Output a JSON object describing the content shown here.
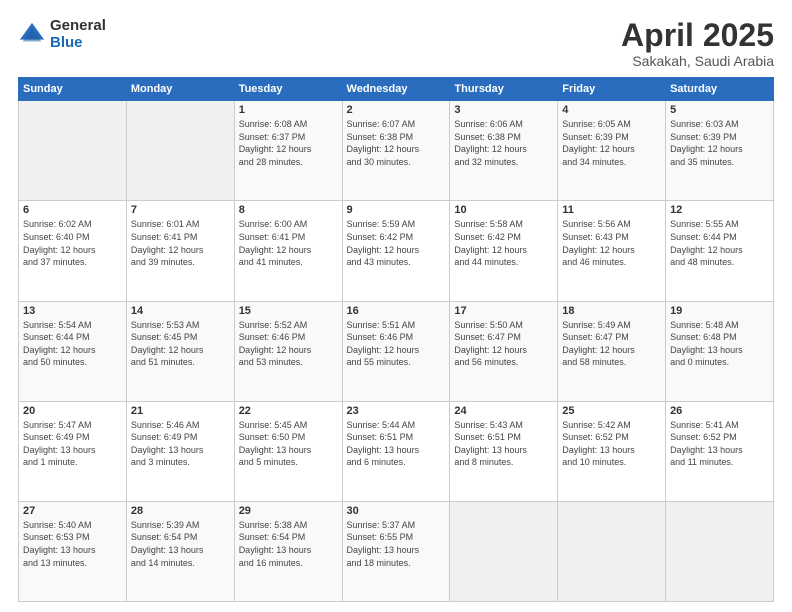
{
  "logo": {
    "general": "General",
    "blue": "Blue"
  },
  "title": "April 2025",
  "subtitle": "Sakakah, Saudi Arabia",
  "days_header": [
    "Sunday",
    "Monday",
    "Tuesday",
    "Wednesday",
    "Thursday",
    "Friday",
    "Saturday"
  ],
  "weeks": [
    [
      {
        "day": "",
        "info": ""
      },
      {
        "day": "",
        "info": ""
      },
      {
        "day": "1",
        "info": "Sunrise: 6:08 AM\nSunset: 6:37 PM\nDaylight: 12 hours\nand 28 minutes."
      },
      {
        "day": "2",
        "info": "Sunrise: 6:07 AM\nSunset: 6:38 PM\nDaylight: 12 hours\nand 30 minutes."
      },
      {
        "day": "3",
        "info": "Sunrise: 6:06 AM\nSunset: 6:38 PM\nDaylight: 12 hours\nand 32 minutes."
      },
      {
        "day": "4",
        "info": "Sunrise: 6:05 AM\nSunset: 6:39 PM\nDaylight: 12 hours\nand 34 minutes."
      },
      {
        "day": "5",
        "info": "Sunrise: 6:03 AM\nSunset: 6:39 PM\nDaylight: 12 hours\nand 35 minutes."
      }
    ],
    [
      {
        "day": "6",
        "info": "Sunrise: 6:02 AM\nSunset: 6:40 PM\nDaylight: 12 hours\nand 37 minutes."
      },
      {
        "day": "7",
        "info": "Sunrise: 6:01 AM\nSunset: 6:41 PM\nDaylight: 12 hours\nand 39 minutes."
      },
      {
        "day": "8",
        "info": "Sunrise: 6:00 AM\nSunset: 6:41 PM\nDaylight: 12 hours\nand 41 minutes."
      },
      {
        "day": "9",
        "info": "Sunrise: 5:59 AM\nSunset: 6:42 PM\nDaylight: 12 hours\nand 43 minutes."
      },
      {
        "day": "10",
        "info": "Sunrise: 5:58 AM\nSunset: 6:42 PM\nDaylight: 12 hours\nand 44 minutes."
      },
      {
        "day": "11",
        "info": "Sunrise: 5:56 AM\nSunset: 6:43 PM\nDaylight: 12 hours\nand 46 minutes."
      },
      {
        "day": "12",
        "info": "Sunrise: 5:55 AM\nSunset: 6:44 PM\nDaylight: 12 hours\nand 48 minutes."
      }
    ],
    [
      {
        "day": "13",
        "info": "Sunrise: 5:54 AM\nSunset: 6:44 PM\nDaylight: 12 hours\nand 50 minutes."
      },
      {
        "day": "14",
        "info": "Sunrise: 5:53 AM\nSunset: 6:45 PM\nDaylight: 12 hours\nand 51 minutes."
      },
      {
        "day": "15",
        "info": "Sunrise: 5:52 AM\nSunset: 6:46 PM\nDaylight: 12 hours\nand 53 minutes."
      },
      {
        "day": "16",
        "info": "Sunrise: 5:51 AM\nSunset: 6:46 PM\nDaylight: 12 hours\nand 55 minutes."
      },
      {
        "day": "17",
        "info": "Sunrise: 5:50 AM\nSunset: 6:47 PM\nDaylight: 12 hours\nand 56 minutes."
      },
      {
        "day": "18",
        "info": "Sunrise: 5:49 AM\nSunset: 6:47 PM\nDaylight: 12 hours\nand 58 minutes."
      },
      {
        "day": "19",
        "info": "Sunrise: 5:48 AM\nSunset: 6:48 PM\nDaylight: 13 hours\nand 0 minutes."
      }
    ],
    [
      {
        "day": "20",
        "info": "Sunrise: 5:47 AM\nSunset: 6:49 PM\nDaylight: 13 hours\nand 1 minute."
      },
      {
        "day": "21",
        "info": "Sunrise: 5:46 AM\nSunset: 6:49 PM\nDaylight: 13 hours\nand 3 minutes."
      },
      {
        "day": "22",
        "info": "Sunrise: 5:45 AM\nSunset: 6:50 PM\nDaylight: 13 hours\nand 5 minutes."
      },
      {
        "day": "23",
        "info": "Sunrise: 5:44 AM\nSunset: 6:51 PM\nDaylight: 13 hours\nand 6 minutes."
      },
      {
        "day": "24",
        "info": "Sunrise: 5:43 AM\nSunset: 6:51 PM\nDaylight: 13 hours\nand 8 minutes."
      },
      {
        "day": "25",
        "info": "Sunrise: 5:42 AM\nSunset: 6:52 PM\nDaylight: 13 hours\nand 10 minutes."
      },
      {
        "day": "26",
        "info": "Sunrise: 5:41 AM\nSunset: 6:52 PM\nDaylight: 13 hours\nand 11 minutes."
      }
    ],
    [
      {
        "day": "27",
        "info": "Sunrise: 5:40 AM\nSunset: 6:53 PM\nDaylight: 13 hours\nand 13 minutes."
      },
      {
        "day": "28",
        "info": "Sunrise: 5:39 AM\nSunset: 6:54 PM\nDaylight: 13 hours\nand 14 minutes."
      },
      {
        "day": "29",
        "info": "Sunrise: 5:38 AM\nSunset: 6:54 PM\nDaylight: 13 hours\nand 16 minutes."
      },
      {
        "day": "30",
        "info": "Sunrise: 5:37 AM\nSunset: 6:55 PM\nDaylight: 13 hours\nand 18 minutes."
      },
      {
        "day": "",
        "info": ""
      },
      {
        "day": "",
        "info": ""
      },
      {
        "day": "",
        "info": ""
      }
    ]
  ]
}
